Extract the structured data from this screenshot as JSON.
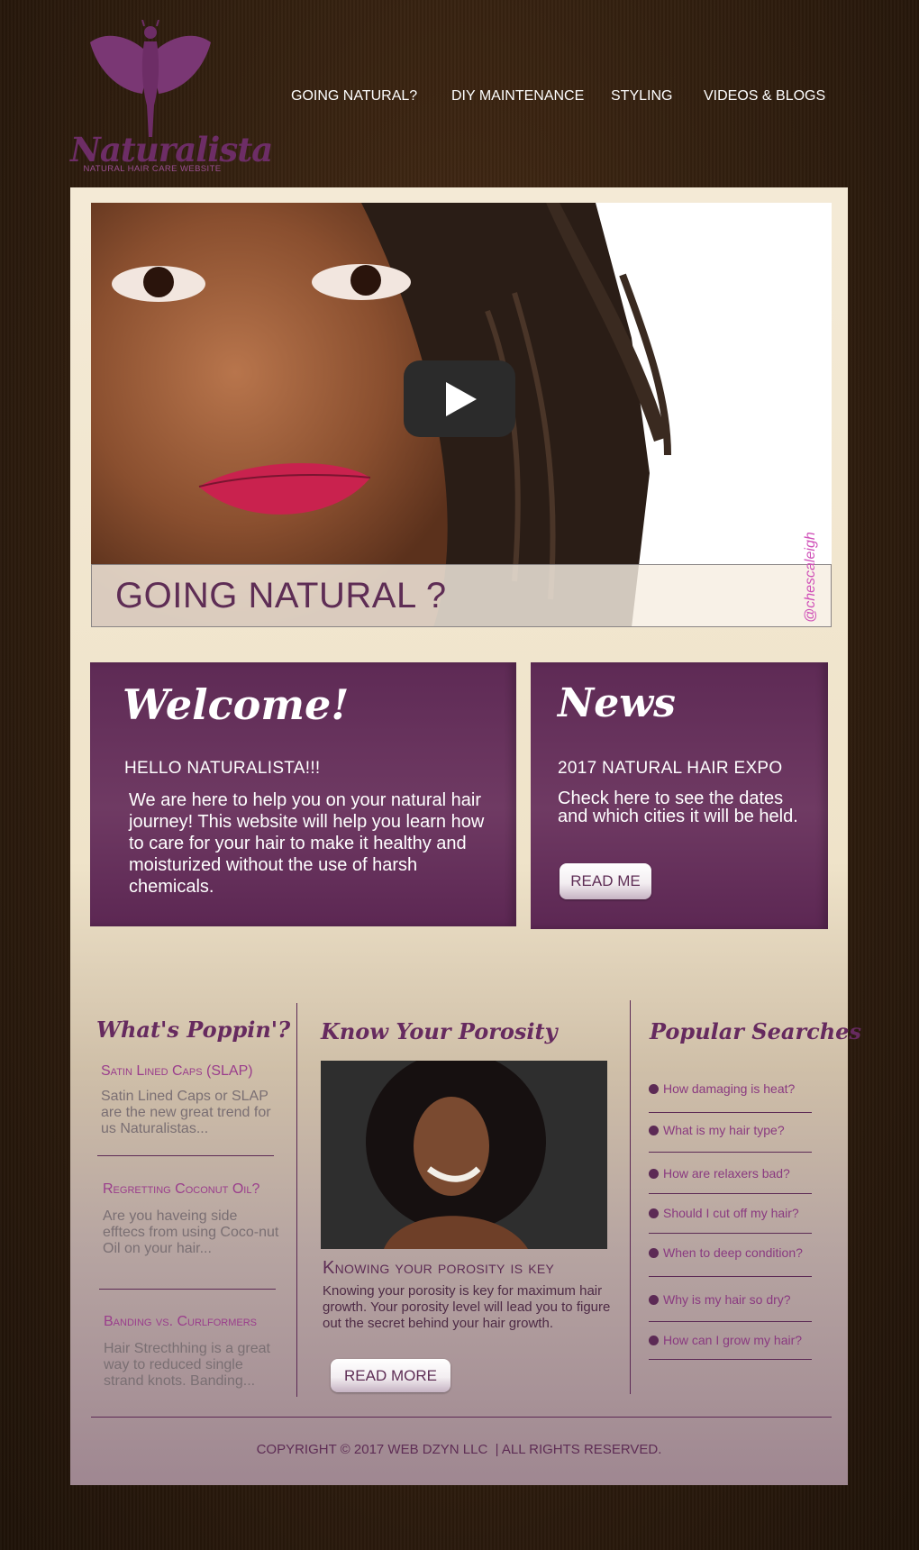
{
  "logo": {
    "name": "Naturalista",
    "tagline": "NATURAL HAIR CARE WEBSITE",
    "brand_color": "#6d2d66"
  },
  "nav": {
    "items": [
      "GOING NATURAL?",
      "DIY MAINTENANCE",
      "STYLING",
      "VIDEOS & BLOGS"
    ]
  },
  "hero": {
    "title": "GOING NATURAL ?",
    "watermark": "@chescaleigh",
    "play_icon": "play-icon"
  },
  "welcome": {
    "heading": "Welcome!",
    "subheading": "HELLO NATURALISTA!!!",
    "body": "We are here to help you on your natural hair journey! This website will help you learn how to care for your hair to make it healthy and moisturized without the use of harsh chemicals."
  },
  "news": {
    "heading": "News",
    "subheading": "2017 NATURAL HAIR EXPO",
    "body": "Check here to see the dates and which cities it will be held.",
    "button": "READ ME"
  },
  "poppin": {
    "heading": "What's Poppin'?",
    "items": [
      {
        "title": "Satin Lined Caps (SLAP)",
        "desc": "Satin Lined Caps or SLAP are the new great trend for us Naturalistas..."
      },
      {
        "title": "Regretting Coconut Oil?",
        "desc": "Are you haveing side efftecs from using Coco-nut Oil on your hair..."
      },
      {
        "title": "Banding vs. Curlformers",
        "desc": "Hair Strecthhing is a great way to reduced single strand knots. Banding..."
      }
    ]
  },
  "porosity": {
    "heading": "Know Your Porosity",
    "title": "Knowing your porosity is key",
    "body": "Knowing your porosity is key for maximum hair growth. Your porosity level will lead you to figure out the secret behind your hair growth.",
    "button": "READ MORE"
  },
  "searches": {
    "heading": "Popular Searches",
    "items": [
      "How damaging is heat?",
      "What is my hair type?",
      "How are relaxers bad?",
      "Should I cut off my hair?",
      "When to deep condition?",
      "Why is my hair so dry?",
      "How can I grow my hair?"
    ]
  },
  "footer": {
    "copyright": "COPYRIGHT © 2017 WEB DZYN LLC  | ALL RIGHTS RESERVED."
  }
}
